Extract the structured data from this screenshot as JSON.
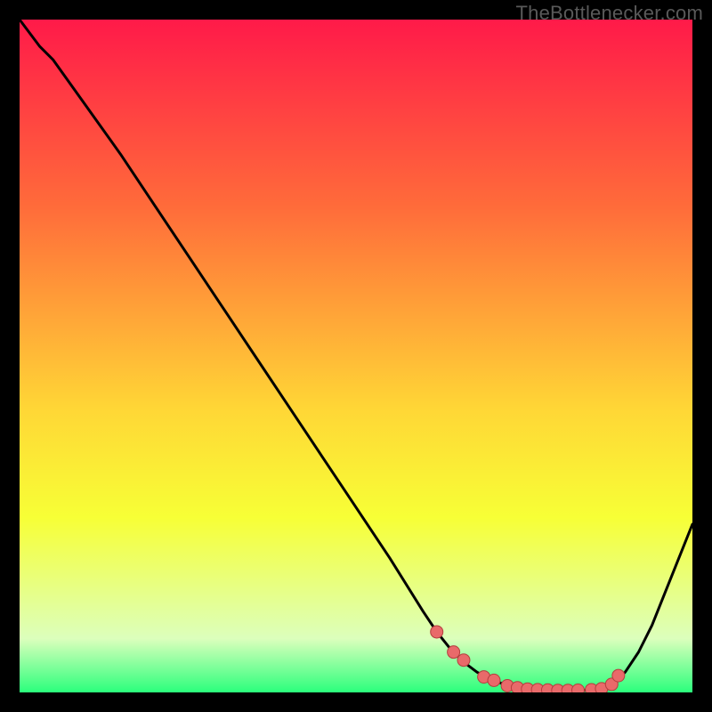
{
  "watermark": "TheBottlenecker.com",
  "colors": {
    "gradient_top": "#ff1a49",
    "gradient_mid1": "#ff6c3a",
    "gradient_mid2": "#ffd736",
    "gradient_mid3": "#f7ff36",
    "gradient_mid4": "#dcffbc",
    "gradient_bottom": "#2bff7c",
    "line": "#000000",
    "marker_fill": "#e96a6a",
    "marker_stroke": "#b43e3e",
    "frame": "#000000"
  },
  "chart_data": {
    "type": "line",
    "title": "",
    "xlabel": "",
    "ylabel": "",
    "xlim": [
      0,
      100
    ],
    "ylim": [
      0,
      100
    ],
    "legend": false,
    "grid": false,
    "series": [
      {
        "name": "bottleneck-curve",
        "x": [
          0,
          3,
          5,
          10,
          15,
          20,
          25,
          30,
          35,
          40,
          45,
          50,
          55,
          60,
          62,
          64,
          66,
          68,
          70,
          72,
          74,
          76,
          78,
          80,
          82,
          84,
          86,
          88,
          90,
          92,
          94,
          96,
          98,
          100
        ],
        "y": [
          100,
          96,
          94,
          87,
          80,
          72.5,
          65,
          57.5,
          50,
          42.5,
          35,
          27.5,
          20,
          12,
          9,
          6.5,
          4.5,
          3,
          2,
          1.2,
          0.7,
          0.45,
          0.35,
          0.3,
          0.3,
          0.35,
          0.5,
          1.2,
          3,
          6,
          10,
          15,
          20,
          25
        ]
      }
    ],
    "markers": {
      "name": "optimal-range-points",
      "x": [
        62,
        64.5,
        66,
        69,
        70.5,
        72.5,
        74,
        75.5,
        77,
        78.5,
        80,
        81.5,
        83,
        85,
        86.5,
        88,
        89
      ],
      "y": [
        9,
        6,
        4.8,
        2.3,
        1.8,
        1.0,
        0.7,
        0.5,
        0.42,
        0.36,
        0.3,
        0.3,
        0.33,
        0.4,
        0.55,
        1.2,
        2.5
      ]
    }
  }
}
